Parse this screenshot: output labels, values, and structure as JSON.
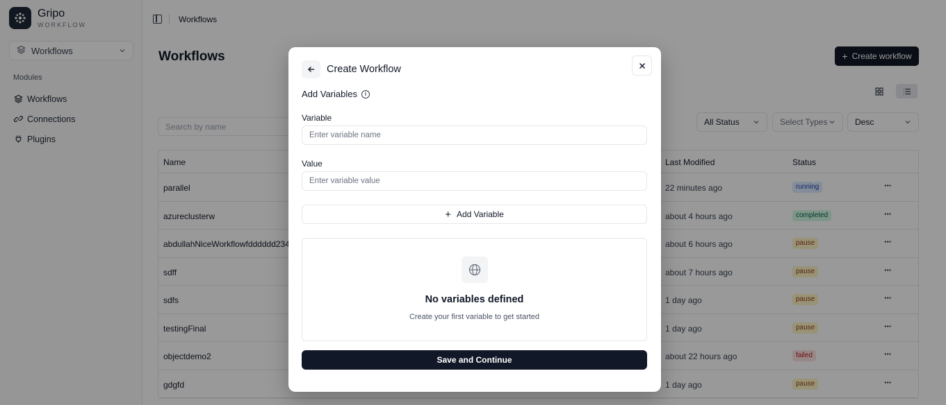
{
  "brand": {
    "name": "Gripo",
    "subtitle": "WORKFLOW"
  },
  "workspace_select": {
    "value": "Workflows"
  },
  "sidebar": {
    "section_title": "Modules",
    "items": [
      {
        "label": "Workflows",
        "icon": "layers-icon"
      },
      {
        "label": "Connections",
        "icon": "link-icon"
      },
      {
        "label": "Plugins",
        "icon": "plug-icon"
      }
    ]
  },
  "topbar": {
    "breadcrumb": "Workflows"
  },
  "page": {
    "title": "Workflows",
    "create_button": "Create workflow",
    "search_placeholder": "Search by name"
  },
  "filters": {
    "status": "All Status",
    "types": "Select Types",
    "sort": "Desc"
  },
  "table": {
    "headers": {
      "name": "Name",
      "last_modified": "Last Modified",
      "status": "Status"
    },
    "rows": [
      {
        "name": "parallel",
        "modified": "22 minutes ago",
        "status": "running"
      },
      {
        "name": "azureclusterw",
        "modified": "about 4 hours ago",
        "status": "completed"
      },
      {
        "name": "abdullahNiceWorkflowfdddddd234",
        "modified": "about 6 hours ago",
        "status": "pause"
      },
      {
        "name": "sdff",
        "modified": "about 7 hours ago",
        "status": "pause"
      },
      {
        "name": "sdfs",
        "modified": "1 day ago",
        "status": "pause"
      },
      {
        "name": "testingFinal",
        "modified": "1 day ago",
        "status": "pause"
      },
      {
        "name": "objectdemo2",
        "modified": "about 22 hours ago",
        "status": "failed"
      },
      {
        "name": "gdgfd",
        "modified": "1 day ago",
        "status": "pause"
      }
    ]
  },
  "modal": {
    "title": "Create Workflow",
    "section_title": "Add Variables",
    "variable_label": "Variable",
    "variable_placeholder": "Enter variable name",
    "value_label": "Value",
    "value_placeholder": "Enter variable value",
    "add_button": "Add Variable",
    "empty_title": "No variables defined",
    "empty_subtitle": "Create your first variable to get started",
    "save_button": "Save and Continue"
  }
}
